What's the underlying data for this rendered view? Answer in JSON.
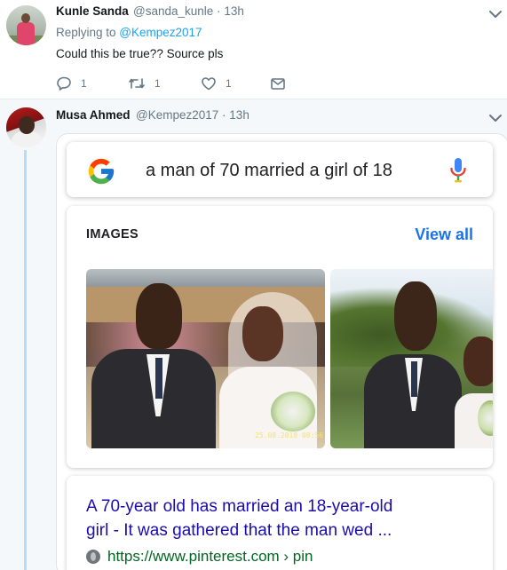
{
  "tweet_reply": {
    "author_name": "Kunle Sanda",
    "author_handle": "@sanda_kunle",
    "separator": "·",
    "time": "13h",
    "replying_prefix": "Replying to ",
    "replying_to": "@Kempez2017",
    "text": "Could this be true?? Source pls",
    "reply_count": "1",
    "retweet_count": "1",
    "like_count": "1"
  },
  "tweet_main": {
    "author_name": "Musa Ahmed",
    "author_handle": "@Kempez2017",
    "separator": "·",
    "time": "13h"
  },
  "embedded_screenshot": {
    "search_query": "a man of 70 married a girl of 18",
    "images_heading": "IMAGES",
    "view_all_label": "View all",
    "photo_date_stamp": "25.08.2018 08:56",
    "result_title_line1": "A 70-year old has married an 18-year-old",
    "result_title_line2": "girl - It was gathered that the man wed ...",
    "result_url": "https://www.pinterest.com › pin"
  },
  "icons": {
    "caret": "chevron-down-icon",
    "reply": "reply-bubble-icon",
    "retweet": "retweet-icon",
    "like": "heart-icon",
    "message": "envelope-icon",
    "google": "google-g-logo",
    "mic": "microphone-icon",
    "globe": "globe-icon"
  },
  "colors": {
    "twitter_blue": "#1da1f2",
    "thread_line": "#b8dcf5",
    "muted_text": "#657786",
    "google_link_blue": "#1a0dab",
    "google_accent_blue": "#1a73e8",
    "url_green": "#006621"
  }
}
